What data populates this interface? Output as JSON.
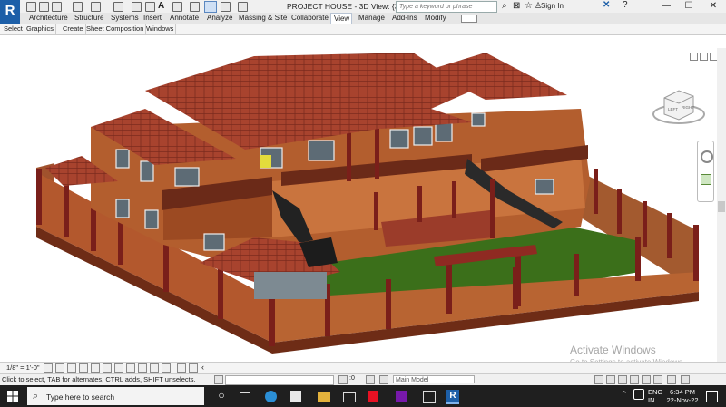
{
  "app": {
    "logo_letter": "R",
    "window_title": "PROJECT HOUSE - 3D View: {3D}"
  },
  "search": {
    "placeholder": "Type a keyword or phrase"
  },
  "account": {
    "sign_in": "Sign In"
  },
  "window_controls": {
    "minimize": "—",
    "maximize": "☐",
    "close": "✕"
  },
  "ribbon": {
    "tabs": [
      "Architecture",
      "Structure",
      "Systems",
      "Insert",
      "Annotate",
      "Analyze",
      "Massing & Site",
      "Collaborate",
      "View",
      "Manage",
      "Add-Ins",
      "Modify"
    ],
    "active_tab": "View",
    "panels": [
      "Select",
      "Graphics",
      "Create",
      "Sheet Composition",
      "Windows"
    ]
  },
  "viewcube": {
    "face_left": "LEFT",
    "face_right": "RIGHT"
  },
  "view_control": {
    "scale": "1/8\" = 1'-0\""
  },
  "status": {
    "message": "Click to select, TAB for alternates, CTRL adds, SHIFT unselects.",
    "workset_value": ":0",
    "model": "Main Model"
  },
  "watermark": {
    "line1": "Activate Windows",
    "line2": "Go to Settings to activate Windows."
  },
  "taskbar": {
    "search_placeholder": "Type here to search",
    "lang_primary": "ENG",
    "lang_secondary": "IN",
    "time": "6:34 PM",
    "date": "22-Nov-22"
  },
  "colors": {
    "roof": "#a8432e",
    "wall": "#b35e2e",
    "fence_cap": "#7a1f1a",
    "lawn": "#3b6f1a",
    "revit_blue": "#1d5fa8"
  }
}
